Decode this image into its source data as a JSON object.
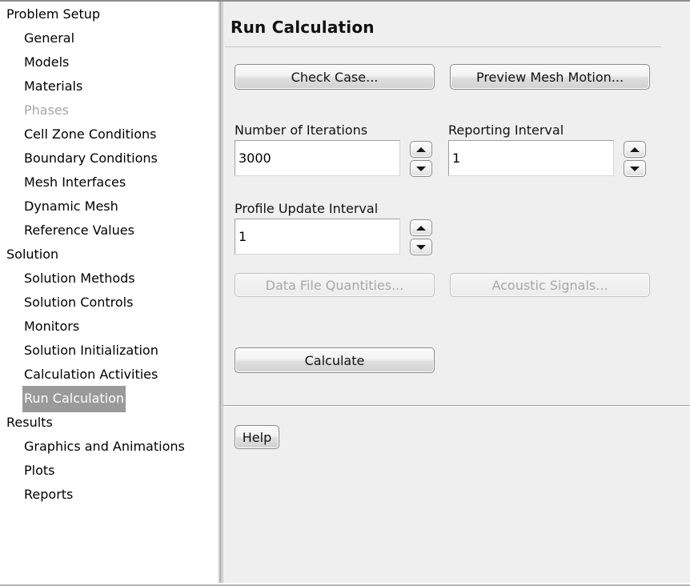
{
  "sidebar": {
    "items": [
      {
        "label": "Problem Setup",
        "level": "group",
        "state": "normal"
      },
      {
        "label": "General",
        "level": "child",
        "state": "normal"
      },
      {
        "label": "Models",
        "level": "child",
        "state": "normal"
      },
      {
        "label": "Materials",
        "level": "child",
        "state": "normal"
      },
      {
        "label": "Phases",
        "level": "child",
        "state": "disabled"
      },
      {
        "label": "Cell Zone Conditions",
        "level": "child",
        "state": "normal"
      },
      {
        "label": "Boundary Conditions",
        "level": "child",
        "state": "normal"
      },
      {
        "label": "Mesh Interfaces",
        "level": "child",
        "state": "normal"
      },
      {
        "label": "Dynamic Mesh",
        "level": "child",
        "state": "normal"
      },
      {
        "label": "Reference Values",
        "level": "child",
        "state": "normal"
      },
      {
        "label": "Solution",
        "level": "group",
        "state": "normal"
      },
      {
        "label": "Solution Methods",
        "level": "child",
        "state": "normal"
      },
      {
        "label": "Solution Controls",
        "level": "child",
        "state": "normal"
      },
      {
        "label": "Monitors",
        "level": "child",
        "state": "normal"
      },
      {
        "label": "Solution Initialization",
        "level": "child",
        "state": "normal"
      },
      {
        "label": "Calculation Activities",
        "level": "child",
        "state": "normal"
      },
      {
        "label": "Run Calculation",
        "level": "child",
        "state": "selected"
      },
      {
        "label": "Results",
        "level": "group",
        "state": "normal"
      },
      {
        "label": "Graphics and Animations",
        "level": "child",
        "state": "normal"
      },
      {
        "label": "Plots",
        "level": "child",
        "state": "normal"
      },
      {
        "label": "Reports",
        "level": "child",
        "state": "normal"
      }
    ]
  },
  "panel": {
    "title": "Run Calculation",
    "buttons": {
      "check_case": "Check Case...",
      "preview_mesh_motion": "Preview Mesh Motion...",
      "data_file_quantities": "Data File Quantities...",
      "acoustic_signals": "Acoustic Signals...",
      "calculate": "Calculate",
      "help": "Help"
    },
    "fields": {
      "number_of_iterations": {
        "label": "Number of Iterations",
        "value": "3000"
      },
      "reporting_interval": {
        "label": "Reporting Interval",
        "value": "1"
      },
      "profile_update_interval": {
        "label": "Profile Update Interval",
        "value": "1"
      }
    },
    "icons": {
      "spinner_up": "triangle-up-icon",
      "spinner_down": "triangle-down-icon"
    }
  },
  "colors": {
    "panel_background": "#efefef",
    "sidebar_background": "#ffffff",
    "selection_highlight": "#9a9a9a",
    "selection_text": "#ffffff",
    "disabled_text": "#a6a6a6"
  }
}
